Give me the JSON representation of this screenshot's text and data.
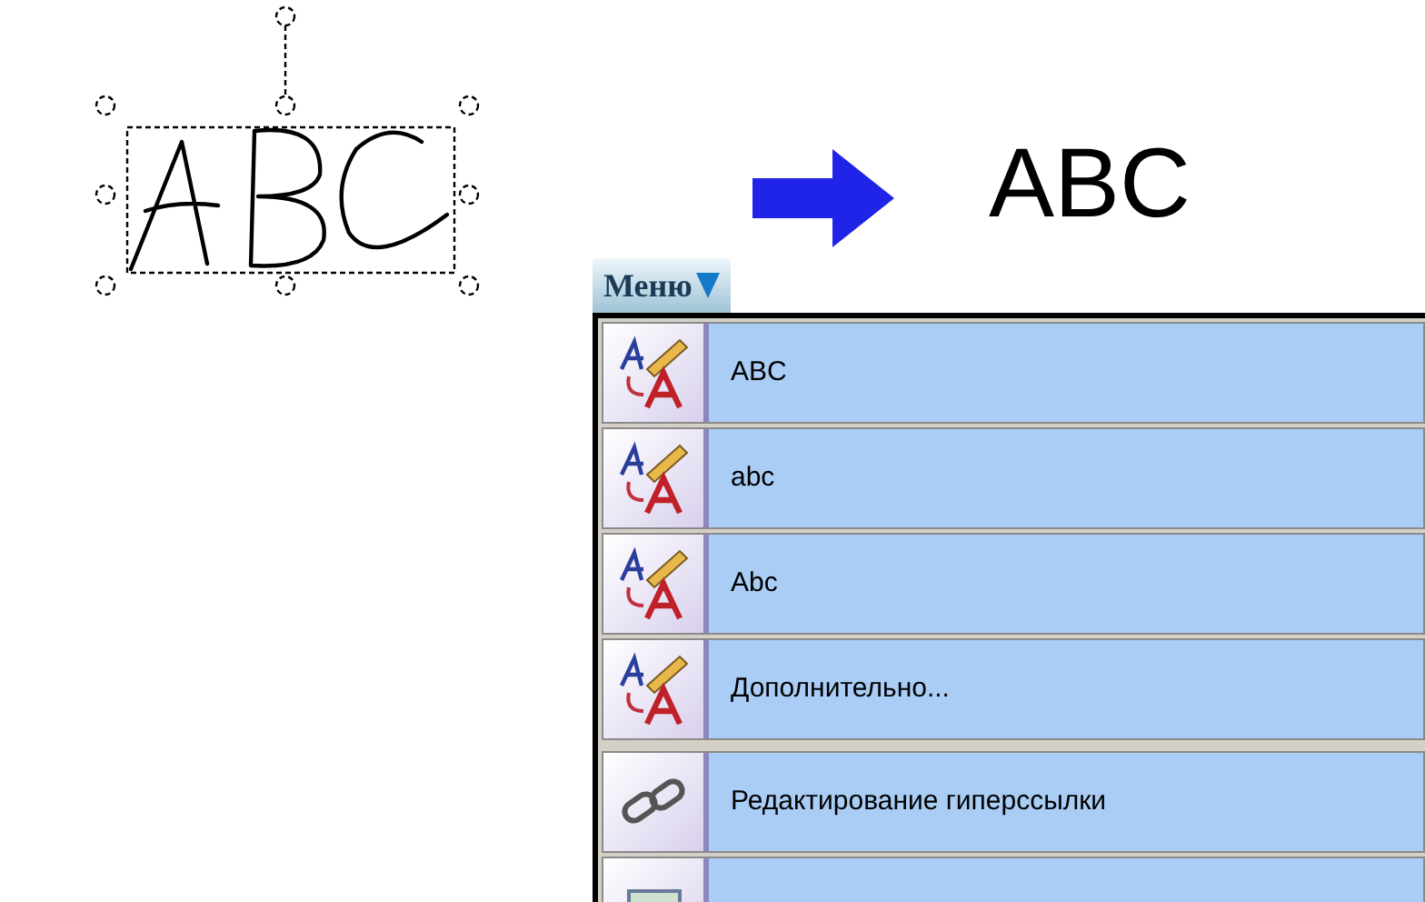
{
  "result_text": "ABC",
  "menu_button": {
    "label": "Меню",
    "expanded": true
  },
  "menu": {
    "items": [
      {
        "kind": "case",
        "label": "ABC",
        "separator_before": false
      },
      {
        "kind": "case",
        "label": "abc",
        "separator_before": false
      },
      {
        "kind": "case",
        "label": "Abc",
        "separator_before": false
      },
      {
        "kind": "case",
        "label": "Дополнительно...",
        "separator_before": false
      },
      {
        "kind": "link",
        "label": "Редактирование гиперссылки",
        "separator_before": true
      },
      {
        "kind": "picture",
        "separator_before": false
      }
    ]
  }
}
